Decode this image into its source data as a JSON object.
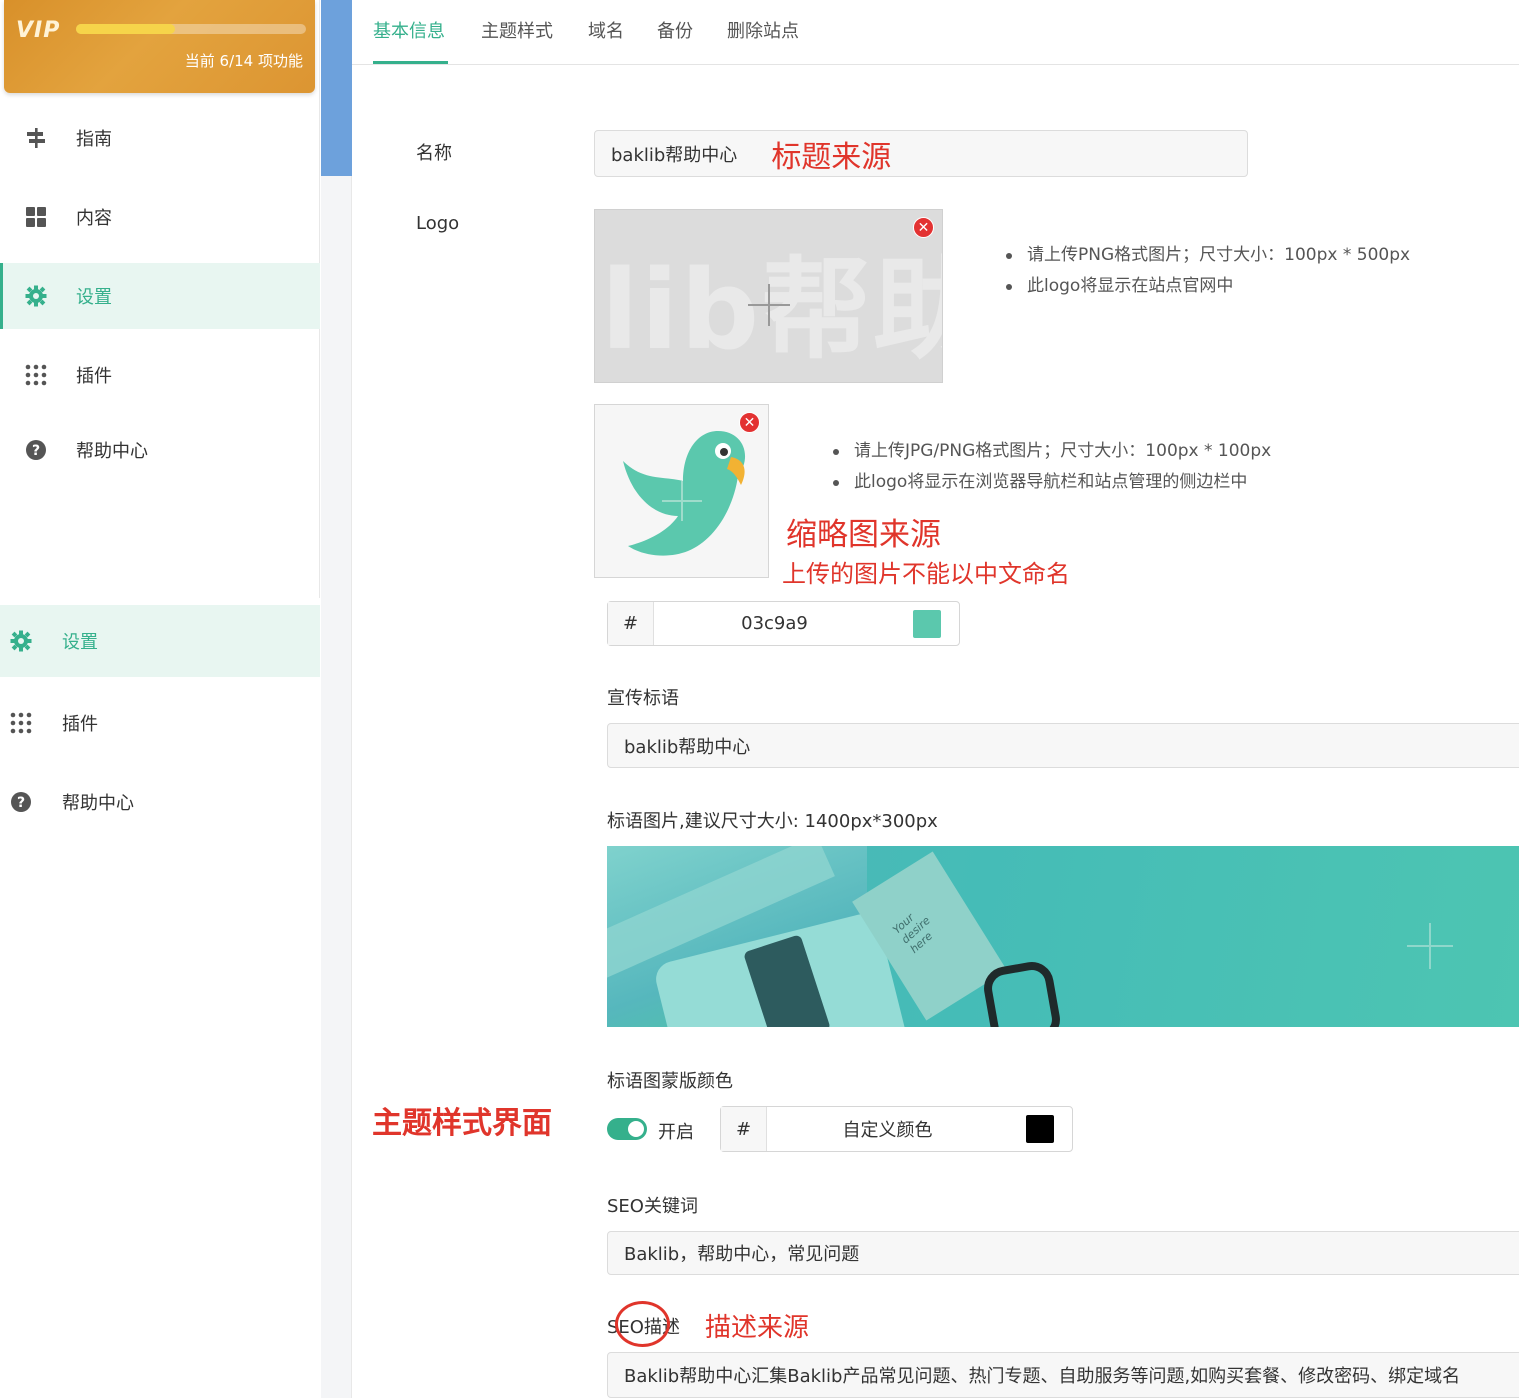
{
  "vip": {
    "badge": "VIP",
    "progress_text": "当前 6/14 项功能",
    "progress": 0.43
  },
  "sidebar": {
    "items": [
      {
        "label": "指南",
        "icon": "signpost-icon"
      },
      {
        "label": "内容",
        "icon": "grid-icon"
      },
      {
        "label": "设置",
        "icon": "gear-icon",
        "active": true
      },
      {
        "label": "插件",
        "icon": "dots-grid-icon"
      },
      {
        "label": "帮助中心",
        "icon": "question-circle-icon"
      }
    ],
    "items2": [
      {
        "label": "设置",
        "icon": "gear-icon",
        "active": true
      },
      {
        "label": "插件",
        "icon": "dots-grid-icon"
      },
      {
        "label": "帮助中心",
        "icon": "question-circle-icon"
      }
    ]
  },
  "tabs": [
    "基本信息",
    "主题样式",
    "域名",
    "备份",
    "删除站点"
  ],
  "form": {
    "name_label": "名称",
    "name_value": "baklib帮助中心",
    "name_annotation": "标题来源",
    "logo_label": "Logo",
    "logo_hints": [
      "请上传PNG格式图片；尺寸大小：100px * 500px",
      "此logo将显示在站点官网中"
    ],
    "logo_watermark": "lib帮助",
    "thumb_hints": [
      "请上传JPG/PNG格式图片；尺寸大小：100px * 100px",
      "此logo将显示在浏览器导航栏和站点管理的侧边栏中"
    ],
    "thumb_annotation": "缩略图来源",
    "thumb_annotation2": "上传的图片不能以中文命名",
    "color_hash": "#",
    "color_value": "03c9a9",
    "slogan_label": "宣传标语",
    "slogan_value": "baklib帮助中心",
    "banner_label": "标语图片,建议尺寸大小: 1400px*300px",
    "banner_card_text": "Your desire here",
    "mask_label": "标语图蒙版颜色",
    "mask_toggle_label": "开启",
    "mask_toggle_on": true,
    "mask_hash": "#",
    "mask_value": "自定义颜色",
    "theme_annotation": "主题样式界面",
    "seo_kw_label": "SEO关键词",
    "seo_kw_value": "Baklib，帮助中心，常见问题",
    "seo_desc_label": "SEO描述",
    "seo_desc_annotation": "描述来源",
    "seo_desc_value": "Baklib帮助中心汇集Baklib产品常见问题、热门专题、自助服务等问题,如购买套餐、修改密码、绑定域名"
  },
  "colors": {
    "accent": "#35b08c",
    "theme_swatch": "#5bc8ad",
    "mask_swatch": "#000000",
    "annotation": "#e0352b"
  }
}
